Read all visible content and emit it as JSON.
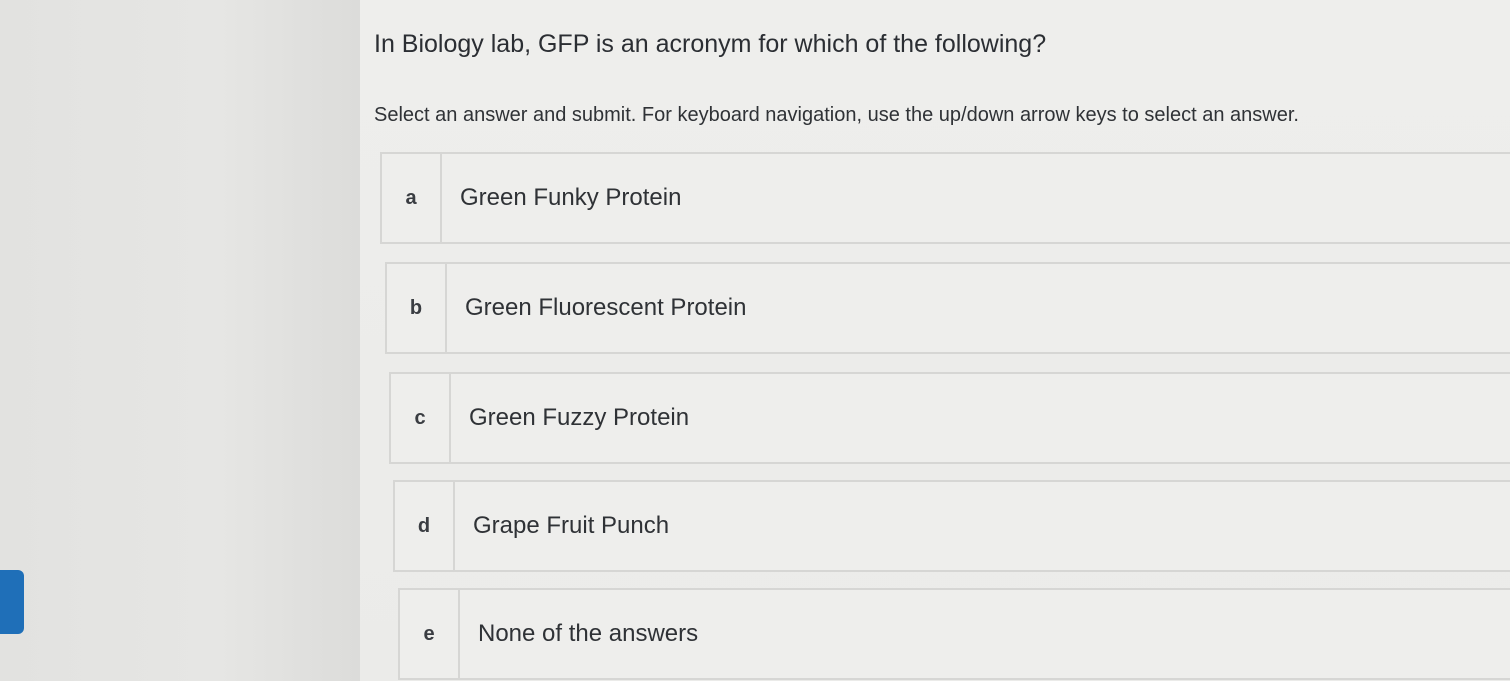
{
  "question": {
    "text": "In Biology lab, GFP is an acronym for which of the following?",
    "instructions": "Select an answer and submit. For keyboard navigation, use the up/down arrow keys to select an answer."
  },
  "options": [
    {
      "letter": "a",
      "text": "Green Funky Protein"
    },
    {
      "letter": "b",
      "text": "Green Fluorescent Protein"
    },
    {
      "letter": "c",
      "text": "Green Fuzzy Protein"
    },
    {
      "letter": "d",
      "text": "Grape Fruit Punch"
    },
    {
      "letter": "e",
      "text": "None of the answers"
    }
  ],
  "colors": {
    "accent": "#1f6fb8",
    "background": "#ebebe9",
    "border": "#d6d6d4"
  }
}
